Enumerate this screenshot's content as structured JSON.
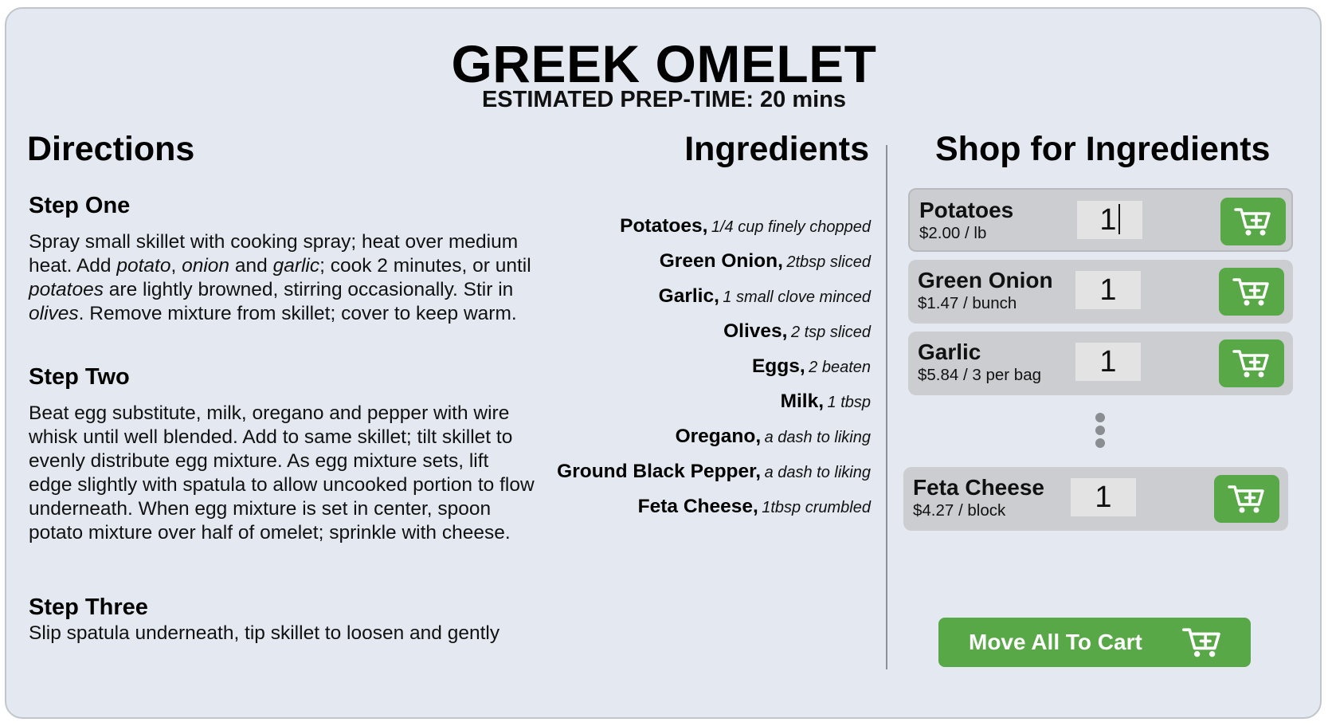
{
  "recipe": {
    "title": "GREEK OMELET",
    "prep_time": "ESTIMATED PREP-TIME: 20 mins"
  },
  "directions": {
    "heading": "Directions",
    "steps": [
      {
        "title": "Step One",
        "segments": [
          "Spray small skillet with cooking spray; heat over medium heat. Add ",
          "potato",
          ", ",
          "onion",
          " and ",
          "garlic",
          "; cook 2 minutes, or until ",
          "potatoes",
          " are lightly browned, stirring occasionally. Stir in ",
          "olives",
          ". Remove mixture from skillet; cover to keep warm."
        ]
      },
      {
        "title": "Step Two",
        "text": "Beat egg substitute, milk, oregano and pepper with wire whisk until well blended. Add to same skillet; tilt skillet to evenly distribute egg mixture. As egg mixture sets, lift edge slightly with spatula to allow uncooked portion to flow underneath. When egg mixture is set in center, spoon potato mixture over half of omelet; sprinkle with cheese."
      },
      {
        "title": "Step Three",
        "text": "Slip spatula underneath, tip skillet to loosen and gently"
      }
    ]
  },
  "ingredients": {
    "heading": "Ingredients",
    "items": [
      {
        "name": "Potatoes,",
        "qty": "1/4 cup finely chopped"
      },
      {
        "name": "Green Onion,",
        "qty": "2tbsp sliced"
      },
      {
        "name": "Garlic,",
        "qty": "1 small clove minced"
      },
      {
        "name": "Olives,",
        "qty": "2 tsp sliced"
      },
      {
        "name": "Eggs,",
        "qty": "2 beaten"
      },
      {
        "name": "Milk,",
        "qty": "1 tbsp"
      },
      {
        "name": "Oregano,",
        "qty": "a dash to liking"
      },
      {
        "name": "Ground Black Pepper,",
        "qty": "a dash to liking"
      },
      {
        "name": "Feta Cheese,",
        "qty": "1tbsp crumbled"
      }
    ]
  },
  "shop": {
    "heading": "Shop for Ingredients",
    "items": [
      {
        "name": "Potatoes",
        "price": "$2.00 / lb",
        "qty": "1",
        "icon": "add-to-cart-icon"
      },
      {
        "name": "Green Onion",
        "price": "$1.47 / bunch",
        "qty": "1",
        "icon": "add-to-cart-icon"
      },
      {
        "name": "Garlic",
        "price": "$5.84 / 3 per bag",
        "qty": "1",
        "icon": "add-to-cart-icon"
      },
      {
        "name": "Feta Cheese",
        "price": "$4.27 / block",
        "qty": "1",
        "icon": "add-to-cart-icon"
      }
    ],
    "more_indicator_icon": "vertical-ellipsis-icon",
    "move_all_label": "Move All To Cart"
  },
  "colors": {
    "background": "#e4e9f1",
    "card": "#cbcdd1",
    "accent_green": "#58a847",
    "divider": "#8d9096"
  }
}
